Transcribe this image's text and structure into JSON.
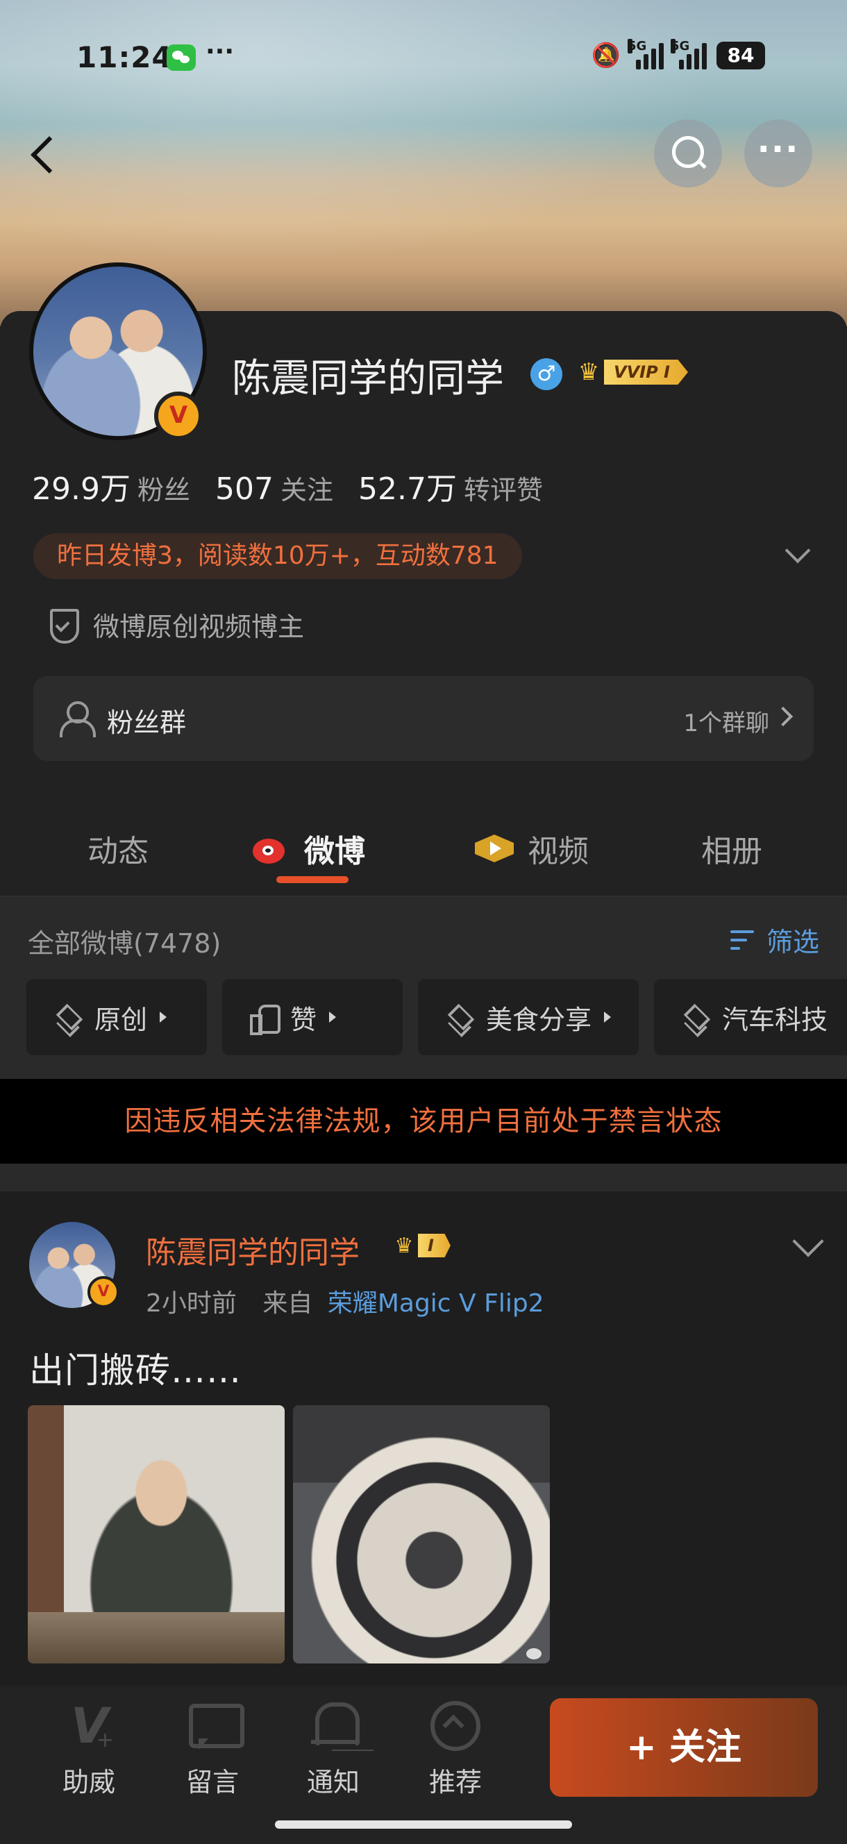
{
  "status_bar": {
    "time": "11:24",
    "network_1": "5G",
    "network_2": "5G",
    "battery": "84"
  },
  "profile": {
    "name": "陈震同学的同学",
    "gender_symbol": "♂",
    "vip_label": "VVIP I",
    "avatar_badge": "V",
    "stats": [
      {
        "value": "29.9万",
        "label": "粉丝"
      },
      {
        "value": "507",
        "label": "关注"
      },
      {
        "value": "52.7万",
        "label": "转评赞"
      }
    ],
    "activity": "昨日发博3，阅读数10万+，互动数781",
    "certification": "微博原创视频博主",
    "fan_group": {
      "label": "粉丝群",
      "count": "1个群聊"
    }
  },
  "tabs": [
    {
      "label": "动态",
      "active": false
    },
    {
      "label": "微博",
      "active": true
    },
    {
      "label": "视频",
      "active": false
    },
    {
      "label": "相册",
      "active": false
    }
  ],
  "filter": {
    "all_posts": "全部微博(7478)",
    "filter_label": "筛选",
    "chips": [
      "原创",
      "赞",
      "美食分享",
      "汽车科技"
    ]
  },
  "ban_notice": "因违反相关法律法规，该用户目前处于禁言状态",
  "post": {
    "author": "陈震同学的同学",
    "vip_label": "I",
    "avatar_badge": "V",
    "time": "2小时前",
    "source_prefix": "来自",
    "source": "荣耀Magic V Flip2",
    "text": "出门搬砖……"
  },
  "bottom_bar": {
    "items": [
      "助威",
      "留言",
      "通知",
      "推荐"
    ],
    "follow_label": "+ 关注"
  },
  "colors": {
    "accent_orange": "#f0703e",
    "link_blue": "#5b9ddd",
    "tab_underline": "#e8502a",
    "follow_button": "#c84a1e"
  }
}
